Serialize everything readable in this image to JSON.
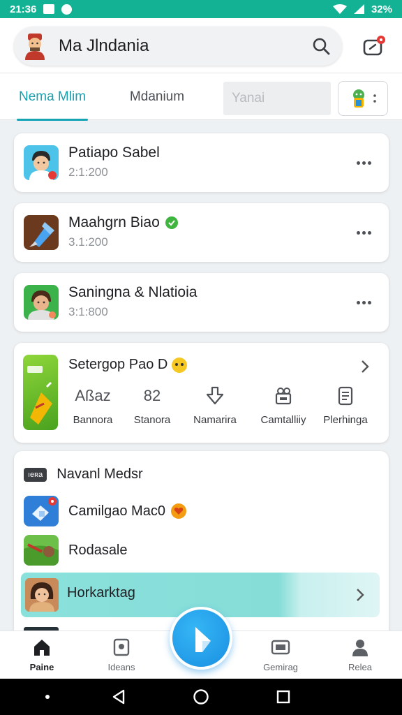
{
  "status_bar": {
    "time": "21:36",
    "battery_text": "32%"
  },
  "header": {
    "title": "Ma Jlndania"
  },
  "tabs": [
    {
      "label": "Nema Mlim",
      "active": true
    },
    {
      "label": "Mdanium",
      "active": false
    },
    {
      "label": "Yanai",
      "active": false
    }
  ],
  "chats": [
    {
      "name": "Patiapo Sabel",
      "time": "2:1:200",
      "verified": false
    },
    {
      "name": "Maahgrn Biao",
      "time": "3.1:200",
      "verified": true
    },
    {
      "name": "Saningna & Nlatioia",
      "time": "3:1:800",
      "verified": false
    }
  ],
  "feature": {
    "title": "Setergop Pao D",
    "stats": [
      {
        "value": "Aßaz",
        "label": "Bannora"
      },
      {
        "value": "82",
        "label": "Stanora"
      },
      {
        "value": "",
        "label": "Namarira",
        "icon": "download-icon"
      },
      {
        "value": "",
        "label": "Camtalliiy",
        "icon": "people-icon"
      },
      {
        "value": "",
        "label": "Plerhinga",
        "icon": "document-icon"
      }
    ]
  },
  "list": {
    "tag": "ıeʀa",
    "title": "Navanl Medsr",
    "rows": [
      {
        "label": "Camilgao Mac0"
      },
      {
        "label": "Rodasale"
      }
    ],
    "highlight": {
      "label": "Horkarktag"
    }
  },
  "bottom_nav": [
    {
      "label": "Paine",
      "icon": "home-icon",
      "active": true
    },
    {
      "label": "Ideans",
      "icon": "photo-icon",
      "active": false
    },
    {
      "label": "Gemirag",
      "icon": "gaming-icon",
      "active": false
    },
    {
      "label": "Relea",
      "icon": "person-icon",
      "active": false
    }
  ],
  "colors": {
    "accent": "#14a4b4",
    "status_bar": "#13b294",
    "fab": "#1a8fe2"
  }
}
